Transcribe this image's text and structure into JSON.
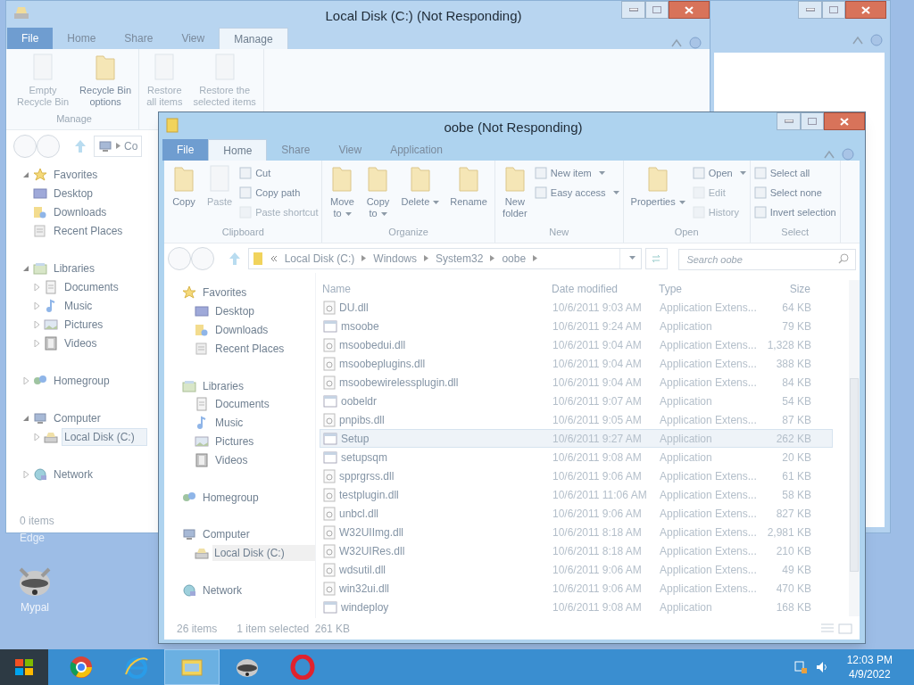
{
  "desktop": {
    "icons": [
      {
        "label": "Edge"
      },
      {
        "label": "Mypal"
      }
    ]
  },
  "window_a": {
    "title": "Local Disk (C:) (Not Responding)",
    "tabs": [
      {
        "kind": "file",
        "label": "File",
        "selected": false
      },
      {
        "kind": "tab",
        "label": "Home",
        "selected": false
      },
      {
        "kind": "tab",
        "label": "Share",
        "selected": false
      },
      {
        "kind": "tab",
        "label": "View",
        "selected": false
      },
      {
        "kind": "tab",
        "label": "Manage",
        "selected": true
      }
    ],
    "ribbon": [
      {
        "label": "Manage",
        "items": [
          {
            "kind": "large",
            "label": "Empty\nRecycle Bin",
            "disabled": true
          },
          {
            "kind": "large",
            "label": "Recycle Bin\noptions",
            "disabled": false
          }
        ]
      },
      {
        "items": [
          {
            "kind": "large",
            "label": "Restore\nall items",
            "disabled": true
          },
          {
            "kind": "large",
            "label": "Restore the\nselected items",
            "disabled": true
          }
        ]
      }
    ],
    "address": [
      "Co"
    ],
    "nav": [
      {
        "label": "Favorites",
        "expanded": true,
        "selected": false,
        "children": [
          {
            "label": "Desktop",
            "selected": false
          },
          {
            "label": "Downloads",
            "selected": false
          },
          {
            "label": "Recent Places",
            "selected": false
          }
        ]
      },
      {
        "label": "Libraries",
        "expanded": true,
        "selected": false,
        "children": [
          {
            "label": "Documents",
            "expanded": false,
            "selected": false
          },
          {
            "label": "Music",
            "expanded": false,
            "selected": false
          },
          {
            "label": "Pictures",
            "expanded": false,
            "selected": false
          },
          {
            "label": "Videos",
            "expanded": false,
            "selected": false
          }
        ]
      },
      {
        "label": "Homegroup",
        "expanded": false,
        "selected": false
      },
      {
        "label": "Computer",
        "expanded": true,
        "selected": false,
        "children": [
          {
            "label": "Local Disk (C:)",
            "expanded": false,
            "selected": true
          }
        ]
      },
      {
        "label": "Network",
        "expanded": false,
        "selected": false
      }
    ],
    "status": [
      "0 items"
    ]
  },
  "window_b": {
    "title": "oobe (Not Responding)",
    "tabs": [
      {
        "kind": "file",
        "label": "File",
        "selected": false
      },
      {
        "kind": "tab",
        "label": "Home",
        "selected": true
      },
      {
        "kind": "tab",
        "label": "Share",
        "selected": false
      },
      {
        "kind": "tab",
        "label": "View",
        "selected": false
      },
      {
        "kind": "tab",
        "label": "Application",
        "selected": false
      }
    ],
    "ribbon": [
      {
        "label": "Clipboard",
        "items": [
          {
            "kind": "large",
            "label": "Copy",
            "disabled": false
          },
          {
            "kind": "large",
            "label": "Paste",
            "disabled": true
          },
          {
            "kind": "small",
            "label": "Cut",
            "disabled": false
          },
          {
            "kind": "small",
            "label": "Copy path",
            "disabled": false
          },
          {
            "kind": "small",
            "label": "Paste shortcut",
            "disabled": true
          }
        ]
      },
      {
        "label": "Organize",
        "items": [
          {
            "kind": "large",
            "label": "Move\nto",
            "disabled": false,
            "dropdown": true
          },
          {
            "kind": "large",
            "label": "Copy\nto",
            "disabled": false,
            "dropdown": true
          },
          {
            "kind": "large",
            "label": "Delete",
            "disabled": false,
            "dropdown": true
          },
          {
            "kind": "large",
            "label": "Rename",
            "disabled": false
          }
        ]
      },
      {
        "label": "New",
        "items": [
          {
            "kind": "large",
            "label": "New\nfolder",
            "disabled": false
          },
          {
            "kind": "small",
            "label": "New item",
            "disabled": false,
            "dropdown": true
          },
          {
            "kind": "small",
            "label": "Easy access",
            "disabled": false,
            "dropdown": true
          }
        ]
      },
      {
        "label": "Open",
        "items": [
          {
            "kind": "large",
            "label": "Properties",
            "disabled": false,
            "dropdown": true
          },
          {
            "kind": "small",
            "label": "Open",
            "disabled": false,
            "dropdown": true
          },
          {
            "kind": "small",
            "label": "Edit",
            "disabled": true
          },
          {
            "kind": "small",
            "label": "History",
            "disabled": true
          }
        ]
      },
      {
        "label": "Select",
        "items": [
          {
            "kind": "small",
            "label": "Select all",
            "disabled": false
          },
          {
            "kind": "small",
            "label": "Select none",
            "disabled": false
          },
          {
            "kind": "small",
            "label": "Invert selection",
            "disabled": false
          }
        ]
      }
    ],
    "address": [
      "Local Disk (C:)",
      "Windows",
      "System32",
      "oobe"
    ],
    "search": {
      "placeholder": "Search oobe"
    },
    "nav": [
      {
        "label": "Favorites",
        "selected": false,
        "children": [
          {
            "label": "Desktop",
            "selected": false
          },
          {
            "label": "Downloads",
            "selected": false
          },
          {
            "label": "Recent Places",
            "selected": false
          }
        ]
      },
      {
        "label": "Libraries",
        "selected": false,
        "children": [
          {
            "label": "Documents",
            "selected": false
          },
          {
            "label": "Music",
            "selected": false
          },
          {
            "label": "Pictures",
            "selected": false
          },
          {
            "label": "Videos",
            "selected": false
          }
        ]
      },
      {
        "label": "Homegroup",
        "selected": false
      },
      {
        "label": "Computer",
        "selected": false,
        "children": [
          {
            "label": "Local Disk (C:)",
            "selected": true
          }
        ]
      },
      {
        "label": "Network",
        "selected": false
      }
    ],
    "columns": [
      "Name",
      "Date modified",
      "Type",
      "Size"
    ],
    "rows": [
      {
        "kind": "dll",
        "selected": false,
        "cells": [
          "DU.dll",
          "10/6/2011 9:03 AM",
          "Application Extens...",
          "64 KB"
        ]
      },
      {
        "kind": "app",
        "selected": false,
        "cells": [
          "msoobe",
          "10/6/2011 9:24 AM",
          "Application",
          "79 KB"
        ]
      },
      {
        "kind": "dll",
        "selected": false,
        "cells": [
          "msoobedui.dll",
          "10/6/2011 9:04 AM",
          "Application Extens...",
          "1,328 KB"
        ]
      },
      {
        "kind": "dll",
        "selected": false,
        "cells": [
          "msoobeplugins.dll",
          "10/6/2011 9:04 AM",
          "Application Extens...",
          "388 KB"
        ]
      },
      {
        "kind": "dll",
        "selected": false,
        "cells": [
          "msoobewirelessplugin.dll",
          "10/6/2011 9:04 AM",
          "Application Extens...",
          "84 KB"
        ]
      },
      {
        "kind": "app",
        "selected": false,
        "cells": [
          "oobeldr",
          "10/6/2011 9:07 AM",
          "Application",
          "54 KB"
        ]
      },
      {
        "kind": "dll",
        "selected": false,
        "cells": [
          "pnpibs.dll",
          "10/6/2011 9:05 AM",
          "Application Extens...",
          "87 KB"
        ]
      },
      {
        "kind": "app",
        "selected": true,
        "cells": [
          "Setup",
          "10/6/2011 9:27 AM",
          "Application",
          "262 KB"
        ]
      },
      {
        "kind": "app",
        "selected": false,
        "cells": [
          "setupsqm",
          "10/6/2011 9:08 AM",
          "Application",
          "20 KB"
        ]
      },
      {
        "kind": "dll",
        "selected": false,
        "cells": [
          "spprgrss.dll",
          "10/6/2011 9:06 AM",
          "Application Extens...",
          "61 KB"
        ]
      },
      {
        "kind": "dll",
        "selected": false,
        "cells": [
          "testplugin.dll",
          "10/6/2011 11:06 AM",
          "Application Extens...",
          "58 KB"
        ]
      },
      {
        "kind": "dll",
        "selected": false,
        "cells": [
          "unbcl.dll",
          "10/6/2011 9:06 AM",
          "Application Extens...",
          "827 KB"
        ]
      },
      {
        "kind": "dll",
        "selected": false,
        "cells": [
          "W32UIImg.dll",
          "10/6/2011 8:18 AM",
          "Application Extens...",
          "2,981 KB"
        ]
      },
      {
        "kind": "dll",
        "selected": false,
        "cells": [
          "W32UIRes.dll",
          "10/6/2011 8:18 AM",
          "Application Extens...",
          "210 KB"
        ]
      },
      {
        "kind": "dll",
        "selected": false,
        "cells": [
          "wdsutil.dll",
          "10/6/2011 9:06 AM",
          "Application Extens...",
          "49 KB"
        ]
      },
      {
        "kind": "dll",
        "selected": false,
        "cells": [
          "win32ui.dll",
          "10/6/2011 9:06 AM",
          "Application Extens...",
          "470 KB"
        ]
      },
      {
        "kind": "app",
        "selected": false,
        "cells": [
          "windeploy",
          "10/6/2011 9:08 AM",
          "Application",
          "168 KB"
        ]
      }
    ],
    "status": [
      "26 items",
      "1 item selected  261 KB"
    ]
  },
  "taskbar": {
    "apps": [
      {
        "selected": false
      },
      {
        "selected": false
      },
      {
        "selected": true
      },
      {
        "selected": false
      },
      {
        "selected": false
      }
    ],
    "time": "12:03 PM",
    "date": "4/9/2022"
  }
}
